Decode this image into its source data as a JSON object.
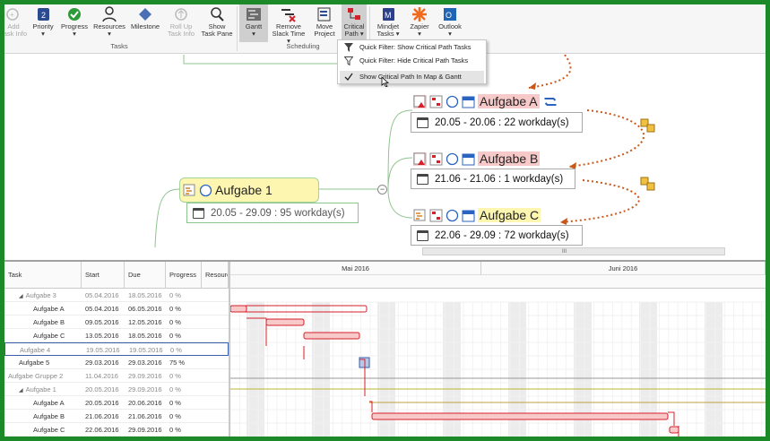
{
  "ribbon": {
    "buttons": [
      {
        "id": "add-task-info",
        "label1": "Add",
        "label2": "Task Info",
        "disabled": true
      },
      {
        "id": "priority",
        "label1": "Priority",
        "label2": "▾",
        "disabled": false
      },
      {
        "id": "progress",
        "label1": "Progress",
        "label2": "▾",
        "disabled": false
      },
      {
        "id": "resources",
        "label1": "Resources",
        "label2": "▾",
        "disabled": false
      },
      {
        "id": "milestone",
        "label1": "Milestone",
        "label2": "",
        "disabled": false
      },
      {
        "id": "roll-up",
        "label1": "Roll Up",
        "label2": "Task Info",
        "disabled": true
      },
      {
        "id": "show-task-pane",
        "label1": "Show",
        "label2": "Task Pane",
        "disabled": false
      },
      {
        "id": "gantt",
        "label1": "Gantt",
        "label2": "▾",
        "disabled": false
      },
      {
        "id": "remove-slack",
        "label1": "Remove",
        "label2": "Slack Time ▾",
        "disabled": false
      },
      {
        "id": "move-project",
        "label1": "Move",
        "label2": "Project",
        "disabled": false
      },
      {
        "id": "critical-path",
        "label1": "Critical",
        "label2": "Path ▾",
        "disabled": false
      },
      {
        "id": "mindjet-tasks",
        "label1": "Mindjet",
        "label2": "Tasks ▾",
        "disabled": false
      },
      {
        "id": "zapier",
        "label1": "Zapier",
        "label2": "▾",
        "disabled": false
      },
      {
        "id": "outlook",
        "label1": "Outlook",
        "label2": "▾",
        "disabled": false
      }
    ],
    "groups": {
      "tasks": "Tasks",
      "scheduling": "Scheduling"
    }
  },
  "menu": {
    "items": [
      {
        "label": "Quick Filter: Show Critical Path Tasks"
      },
      {
        "label": "Quick Filter: Hide Critical Path Tasks"
      },
      {
        "label": "Show Critical Path In Map & Gantt"
      }
    ]
  },
  "map": {
    "aufgabe1": {
      "title": "Aufgabe 1",
      "dates": "20.05 - 29.09 : 95 workday(s)"
    },
    "aufgabeA": {
      "title": "Aufgabe A",
      "dates": "20.05 - 20.06 : 22 workday(s)"
    },
    "aufgabeB": {
      "title": "Aufgabe B",
      "dates": "21.06 - 21.06 : 1 workday(s)"
    },
    "aufgabeC": {
      "title": "Aufgabe C",
      "dates": "22.06 - 29.09 : 72 workday(s)"
    },
    "scroll_label": "III"
  },
  "gantt": {
    "columns": {
      "task": "Task",
      "start": "Start",
      "due": "Due",
      "progress": "Progress",
      "resources": "Resourc"
    },
    "months": [
      "Mai 2016",
      "Juni 2016"
    ],
    "rows": [
      {
        "task": "Aufgabe 3",
        "start": "05.04.2016",
        "due": "18.05.2016",
        "progress": "0 %",
        "indent": 1,
        "expander": true,
        "grey": true
      },
      {
        "task": "Aufgabe A",
        "start": "05.04.2016",
        "due": "06.05.2016",
        "progress": "0 %",
        "indent": 2,
        "expander": false,
        "grey": false
      },
      {
        "task": "Aufgabe B",
        "start": "09.05.2016",
        "due": "12.05.2016",
        "progress": "0 %",
        "indent": 2,
        "expander": false,
        "grey": false
      },
      {
        "task": "Aufgabe C",
        "start": "13.05.2016",
        "due": "18.05.2016",
        "progress": "0 %",
        "indent": 2,
        "expander": false,
        "grey": false
      },
      {
        "task": "Aufgabe 4",
        "start": "19.05.2016",
        "due": "19.05.2016",
        "progress": "0 %",
        "indent": 1,
        "expander": false,
        "grey": true,
        "selected": true
      },
      {
        "task": "Aufgabe 5",
        "start": "29.03.2016",
        "due": "29.03.2016",
        "progress": "75 %",
        "indent": 1,
        "expander": false,
        "grey": false
      },
      {
        "task": "Aufgabe Gruppe 2",
        "start": "11.04.2016",
        "due": "29.09.2016",
        "progress": "0 %",
        "indent": 0,
        "expander": false,
        "grey": true
      },
      {
        "task": "Aufgabe 1",
        "start": "20.05.2016",
        "due": "29.09.2016",
        "progress": "0 %",
        "indent": 1,
        "expander": true,
        "grey": true
      },
      {
        "task": "Aufgabe A",
        "start": "20.05.2016",
        "due": "20.06.2016",
        "progress": "0 %",
        "indent": 2,
        "expander": false,
        "grey": false
      },
      {
        "task": "Aufgabe B",
        "start": "21.06.2016",
        "due": "21.06.2016",
        "progress": "0 %",
        "indent": 2,
        "expander": false,
        "grey": false
      },
      {
        "task": "Aufgabe C",
        "start": "22.06.2016",
        "due": "29.09.2016",
        "progress": "0 %",
        "indent": 2,
        "expander": false,
        "grey": false
      }
    ]
  },
  "colors": {
    "critical": "#d4202b",
    "critical_fill": "#f8c9c9",
    "highlight_yellow": "#fdf6b0",
    "frame": "#1d8a2a"
  }
}
